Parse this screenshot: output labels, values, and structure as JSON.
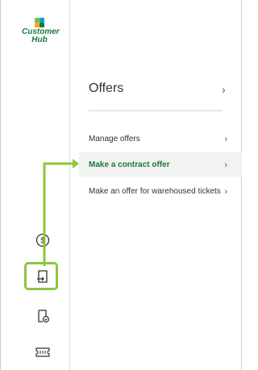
{
  "brand": {
    "line1": "Customer",
    "line2": "Hub",
    "colors": [
      "#7ac143",
      "#00a0e0",
      "#f5a623",
      "#1a7a3c"
    ]
  },
  "rail": {
    "icons": [
      "dollar-circle-icon",
      "transfer-document-icon",
      "document-check-icon",
      "ticket-icon"
    ]
  },
  "panel": {
    "title": "Offers",
    "title_chevron": "›",
    "items": [
      {
        "label": "Manage offers",
        "chevron": "›",
        "active": false
      },
      {
        "label": "Make a contract offer",
        "chevron": "›",
        "active": true
      },
      {
        "label": "Make an offer for warehoused tickets",
        "chevron": "›",
        "active": false
      }
    ]
  },
  "accent": {
    "highlight": "#8cc63f",
    "active_text": "#1a7a3c"
  }
}
